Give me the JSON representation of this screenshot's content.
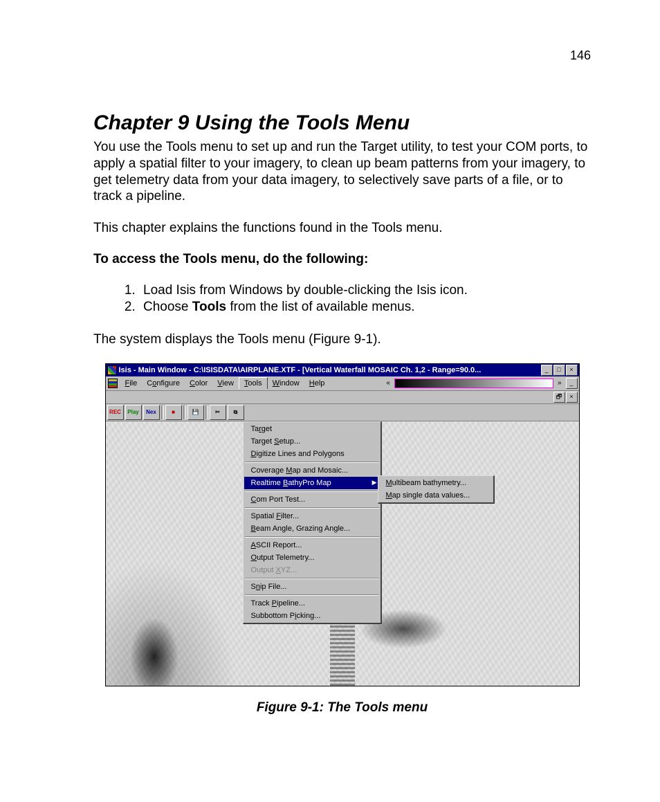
{
  "page_number": "146",
  "chapter_title": "Chapter 9  Using the Tools Menu",
  "para1": "You use the Tools menu to set up and run the Target utility, to test your COM ports, to apply a spatial filter to your imagery, to clean up beam patterns from your imagery, to get telemetry data from your data imagery, to selectively save parts of a file, or to track a pipeline.",
  "para2": "This chapter explains the functions found in the Tools menu.",
  "access_heading": "To access the Tools menu, do the following:",
  "steps": {
    "s1_pre": "Load Isis from Windows by double-clicking the Isis icon.",
    "s2_pre": "Choose ",
    "s2_bold": "Tools",
    "s2_post": " from the list of available menus."
  },
  "para3": "The system displays the Tools menu (Figure 9-1).",
  "figure_caption": "Figure 9-1: The Tools menu",
  "screenshot": {
    "titlebar": "Isis - Main Window - C:\\ISISDATA\\AIRPLANE.XTF - [Vertical Waterfall MOSAIC  Ch. 1,2 - Range=90.0...",
    "win_min": "_",
    "win_max": "□",
    "win_close": "×",
    "menubar": {
      "file": "File",
      "configure": "Configure",
      "color": "Color",
      "view": "View",
      "tools": "Tools",
      "window": "Window",
      "help": "Help",
      "left_chev": "«",
      "right_chev": "»"
    },
    "toolbar": {
      "rec": "REC",
      "play": "Play",
      "next": "Nex",
      "stop": "■",
      "save": "💾",
      "cut": "✂",
      "copy": "⧉"
    },
    "tools_menu": {
      "target": "Target",
      "target_setup": "Target Setup...",
      "digitize": "Digitize Lines and Polygons",
      "coverage": "Coverage Map and Mosaic...",
      "realtime": "Realtime BathyPro Map",
      "com_port": "Com Port Test...",
      "spatial": "Spatial Filter...",
      "beam": "Beam Angle, Grazing Angle...",
      "ascii": "ASCII Report...",
      "output_tel": "Output Telemetry...",
      "output_xyz": "Output XYZ...",
      "snip": "Snip File...",
      "track": "Track Pipeline...",
      "subbottom": "Subbottom Picking..."
    },
    "submenu": {
      "multibeam": "Multibeam bathymetry...",
      "mapsingle": "Map single data values..."
    }
  }
}
